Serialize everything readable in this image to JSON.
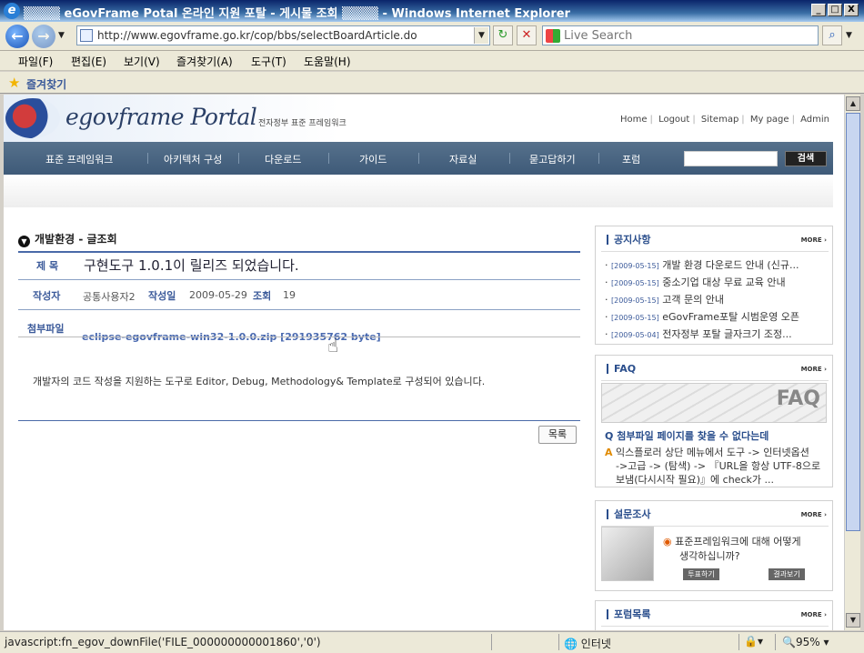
{
  "window": {
    "title": "▒▒▒▒ eGovFrame Potal 온라인 지원 포탈 - 게시물 조회 ▒▒▒▒ - Windows Internet Explorer",
    "min": "_",
    "max": "□",
    "close": "X"
  },
  "nav": {
    "url": "http://www.egovframe.go.kr/cop/bbs/selectBoardArticle.do",
    "search_placeholder": "Live Search"
  },
  "menu": [
    "파일(F)",
    "편집(E)",
    "보기(V)",
    "즐겨찾기(A)",
    "도구(T)",
    "도움말(H)"
  ],
  "favorites": {
    "label": "즐겨찾기"
  },
  "site": {
    "logo": "egovframe Portal",
    "logo_sub": "전자정부 표준 프레임워크",
    "toplinks": [
      "Home",
      "Logout",
      "Sitemap",
      "My page",
      "Admin"
    ],
    "gnb": [
      "표준 프레임워크",
      "아키텍처 구성",
      "다운로드",
      "가이드",
      "자료실",
      "묻고답하기",
      "포럼"
    ],
    "search_btn": "검색"
  },
  "article": {
    "section_title": "개발환경 - 글조회",
    "subject_label": "제 목",
    "subject": "구현도구 1.0.1이 릴리즈 되었습니다.",
    "author_label": "작성자",
    "author": "공통사용자2",
    "date_label": "작성일",
    "date": "2009-05-29",
    "views_label": "조회",
    "views": "19",
    "attach_label": "첨부파일",
    "attach": "eclipse-egovframe-win32-1.0.0.zip [291935762 byte]",
    "body": "개발자의 코드 작성을 지원하는 도구로 Editor, Debug, Methodology& Template로 구성되어 있습니다.",
    "list_btn": "목록"
  },
  "notice": {
    "title": "공지사항",
    "more": "MORE ›",
    "items": [
      {
        "date": "[2009-05-15]",
        "text": "개발 환경 다운로드 안내 (신규..."
      },
      {
        "date": "[2009-05-15]",
        "text": "중소기업 대상 무료 교육 안내"
      },
      {
        "date": "[2009-05-15]",
        "text": "고객 문의 안내"
      },
      {
        "date": "[2009-05-15]",
        "text": "eGovFrame포탈 시범운영 오픈"
      },
      {
        "date": "[2009-05-04]",
        "text": "전자정부 포탈 글자크기 조정..."
      }
    ]
  },
  "faq": {
    "title": "FAQ",
    "more": "MORE ›",
    "img_text": "FAQ",
    "q_mark": "Q",
    "q": "첨부파일 페이지를 찾을 수 없다는데",
    "a_mark": "A",
    "a": [
      "익스플로러 상단 메뉴에서 도구 -> 인터넷옵션",
      "->고급 -> (탐색) -> 『URL을 항상 UTF-8으로",
      "보냄(다시시작 필요)』에 check가 ..."
    ]
  },
  "poll": {
    "title": "설문조사",
    "more": "MORE ›",
    "question": [
      "표준프레임워크에 대해 어떻게",
      "생각하십니까?"
    ],
    "vote": "투표하기",
    "result": "결과보기"
  },
  "forum": {
    "title": "포럼목록",
    "more": "MORE ›"
  },
  "status": {
    "message": "javascript:fn_egov_downFile('FILE_000000000001860','0')",
    "zone": "인터넷",
    "zoom": "95%"
  }
}
